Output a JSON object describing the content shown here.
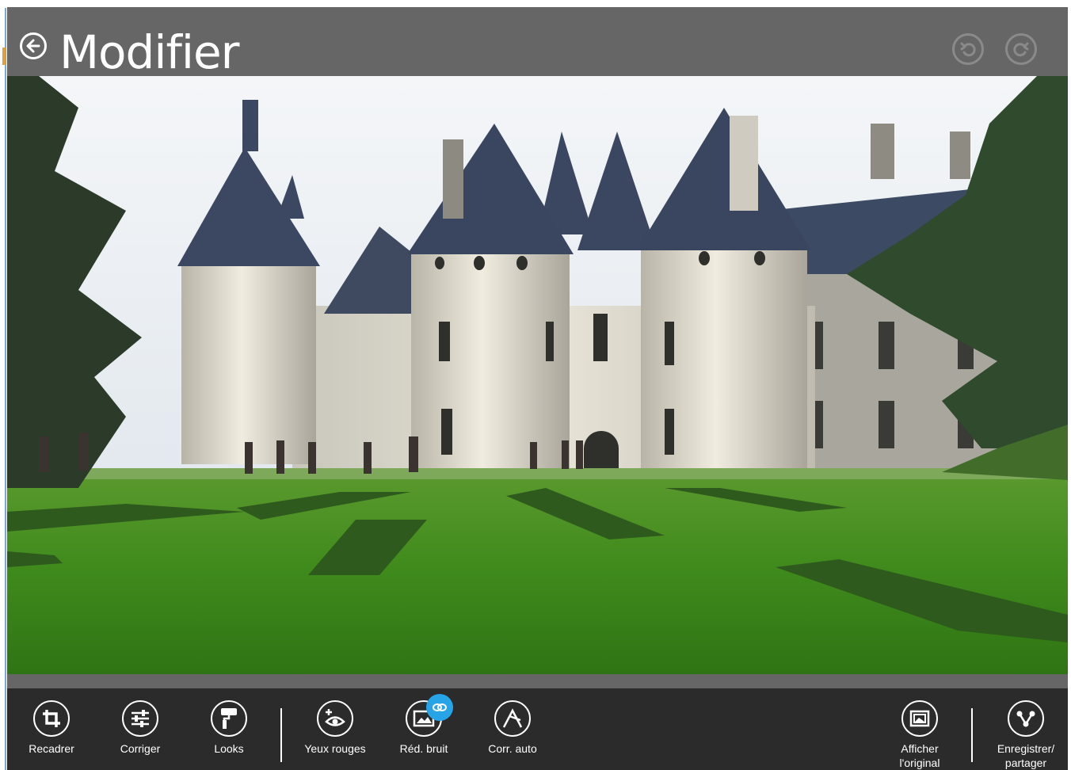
{
  "header": {
    "title": "Modifier",
    "back_icon": "back-arrow-icon",
    "undo_icon": "undo-icon",
    "redo_icon": "redo-icon"
  },
  "photo": {
    "subject": "castle-photo"
  },
  "appbar": {
    "commands": [
      {
        "id": "recadrer",
        "label": "Recadrer",
        "icon": "crop-icon"
      },
      {
        "id": "corriger",
        "label": "Corriger",
        "icon": "sliders-icon"
      },
      {
        "id": "looks",
        "label": "Looks",
        "icon": "paint-roller-icon"
      },
      {
        "id": "yeux-rouges",
        "label": "Yeux rouges",
        "icon": "red-eye-icon"
      },
      {
        "id": "red-bruit",
        "label": "Réd. bruit",
        "icon": "noise-reduction-icon"
      },
      {
        "id": "corr-auto",
        "label": "Corr. auto",
        "icon": "magic-wand-icon"
      },
      {
        "id": "afficher-original",
        "label": "Afficher l'original",
        "icon": "original-image-icon"
      },
      {
        "id": "enregistrer-partager",
        "label": "Enregistrer/ partager",
        "icon": "share-icon"
      }
    ]
  },
  "colors": {
    "titlebar": "#666666",
    "appbar": "#2b2b2b",
    "badge": "#27a3e8"
  }
}
